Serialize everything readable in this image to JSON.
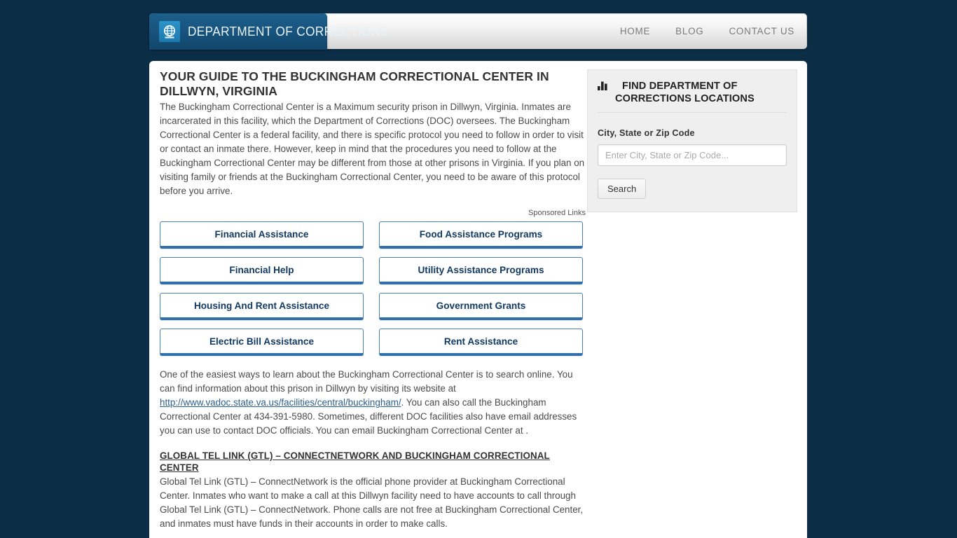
{
  "site": {
    "brand_name": "DEPARTMENT OF CORRECTIONS",
    "logo_icon": "globe-icon",
    "background_color": "#0b2d45",
    "brand_color": "#17537d",
    "link_color": "#2a5f8f"
  },
  "nav": {
    "items": [
      {
        "label": "HOME"
      },
      {
        "label": "BLOG"
      },
      {
        "label": "CONTACT US"
      }
    ]
  },
  "article": {
    "title": "YOUR GUIDE TO THE BUCKINGHAM CORRECTIONAL CENTER IN DILLWYN, VIRGINIA",
    "intro": "The Buckingham Correctional Center is a Maximum security prison in Dillwyn, Virginia. Inmates are incarcerated in this facility, which the Department of Corrections (DOC) oversees. The Buckingham Correctional Center is a federal facility, and there is specific protocol you need to follow in order to visit or contact an inmate there. However, keep in mind that the procedures you need to follow at the Buckingham Correctional Center may be different from those at other prisons in Virginia. If you plan on visiting family or friends at the Buckingham Correctional Center, you need to be aware of this protocol before you arrive.",
    "search_online_part1": "One of the easiest ways to learn about the Buckingham Correctional Center is to search online. You can find information about this prison in Dillwyn by visiting its website at ",
    "website_url": "http://www.vadoc.state.va.us/facilities/central/buckingham/",
    "search_online_part2": ". You can also call the Buckingham Correctional Center at 434-391-5980. Sometimes, different DOC facilities also have email addresses you can use to contact DOC officials. You can email Buckingham Correctional Center at .",
    "gtl_heading": "GLOBAL TEL LINK (GTL) – CONNECTNETWORK AND BUCKINGHAM CORRECTIONAL CENTER",
    "gtl_body": "Global Tel Link (GTL) – ConnectNetwork is the official phone provider at Buckingham Correctional Center. Inmates who want to make a call at this Dillwyn facility need to have accounts to call through Global Tel Link (GTL) – ConnectNetwork. Phone calls are not free at Buckingham Correctional Center, and inmates must have funds in their accounts in order to make calls."
  },
  "ads": {
    "sponsored_label": "Sponsored Links",
    "buttons": [
      {
        "label": "Financial Assistance"
      },
      {
        "label": "Food Assistance Programs"
      },
      {
        "label": "Financial Help"
      },
      {
        "label": "Utility Assistance Programs"
      },
      {
        "label": "Housing And Rent Assistance"
      },
      {
        "label": "Government Grants"
      },
      {
        "label": "Electric Bill Assistance"
      },
      {
        "label": "Rent Assistance"
      }
    ]
  },
  "sidebar": {
    "widget": {
      "icon": "bar-chart-icon",
      "title": "FIND DEPARTMENT OF CORRECTIONS LOCATIONS",
      "field_label": "City, State or Zip Code",
      "input_value": "",
      "input_placeholder": "Enter City, State or Zip Code...",
      "search_button_label": "Search"
    }
  }
}
